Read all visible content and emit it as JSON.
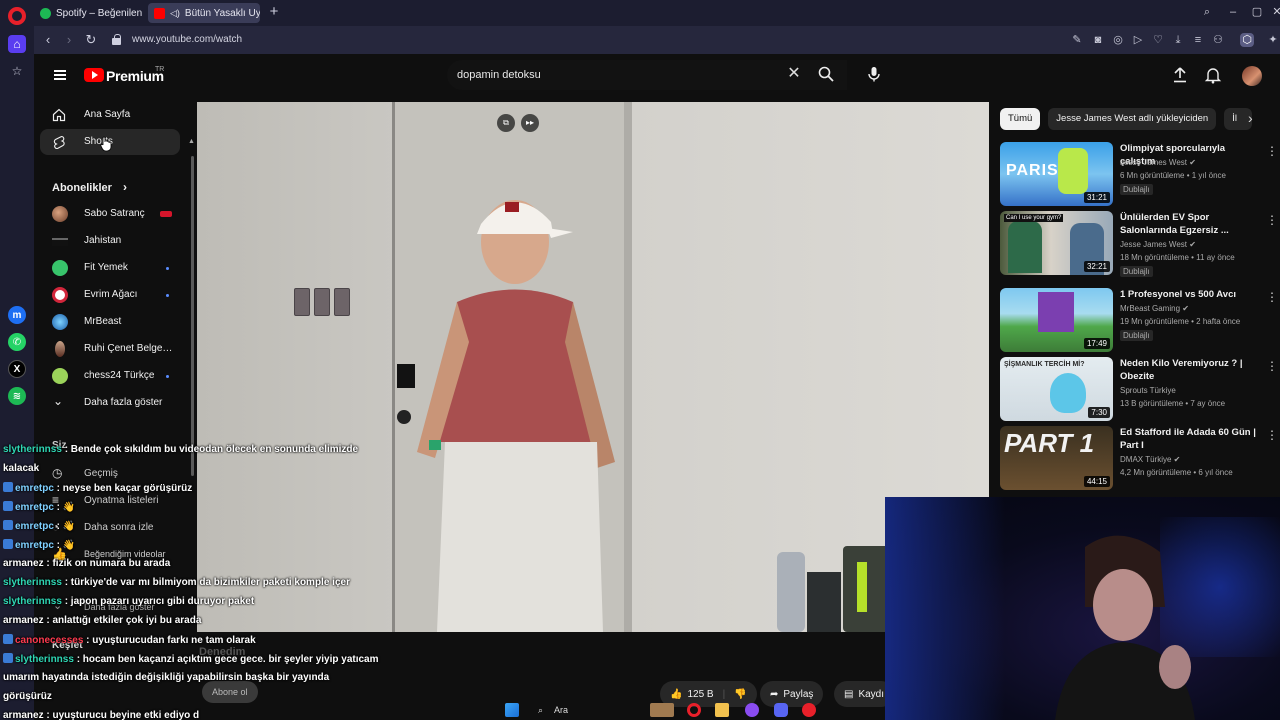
{
  "browser": {
    "tabs": [
      {
        "title": "Spotify – Beğenilen Şarkıl"
      },
      {
        "title": "Bütün Yasaklı Uyarıcıl"
      }
    ],
    "url": "www.youtube.com/watch"
  },
  "youtube": {
    "brand": "Premium",
    "region": "TR",
    "search_value": "dopamin detoksu",
    "sidebar": {
      "items": [
        {
          "label": "Ana Sayfa"
        },
        {
          "label": "Shorts"
        }
      ],
      "subscriptions_heading": "Abonelikler",
      "subscriptions": [
        {
          "name": "Sabo Satranç"
        },
        {
          "name": "Jahistan"
        },
        {
          "name": "Fit Yemek"
        },
        {
          "name": "Evrim Ağacı"
        },
        {
          "name": "MrBeast"
        },
        {
          "name": "Ruhi Çenet Belgese..."
        },
        {
          "name": "chess24 Türkçe"
        }
      ],
      "show_more": "Daha fazla göster",
      "you_heading": "Siz",
      "you_items": [
        {
          "label": "Geçmiş"
        },
        {
          "label": "Oynatma listeleri"
        },
        {
          "label": "Daha sonra izle"
        },
        {
          "label": "Beğendiğim videolar"
        }
      ],
      "show_more_2": "Daha fazla göster",
      "explore_heading": "Keşfet"
    },
    "below_video": {
      "channel_partial": "Denedim",
      "subscribe": "Abone ol",
      "likes": "125 B",
      "share": "Paylaş",
      "save": "Kaydı"
    },
    "filter_chips": [
      "Tümü",
      "Jesse James West adlı yükleyiciden",
      "İl"
    ],
    "recommendations": [
      {
        "title": "Olimpiyat sporcularıyla çalıştım",
        "channel": "Jesse James West",
        "views": "6 Mn görüntüleme • 1 yıl önce",
        "badge": "Dublajlı",
        "duration": "31:21"
      },
      {
        "title": "Ünlülerden EV Spor Salonlarında Egzersiz ...",
        "channel": "Jesse James West",
        "views": "18 Mn görüntüleme • 11 ay önce",
        "badge": "Dublajlı",
        "duration": "32:21"
      },
      {
        "title": "1 Profesyonel vs 500 Avcı",
        "channel": "MrBeast Gaming",
        "views": "19 Mn görüntüleme • 2 hafta önce",
        "badge": "Dublajlı",
        "duration": "17:49"
      },
      {
        "title": "Neden Kilo Veremiyoruz ? | Obezite",
        "channel": "Sprouts Türkiye",
        "views": "13 B görüntüleme • 7 ay önce",
        "badge": "",
        "duration": "7:30"
      },
      {
        "title": "Ed Stafford ile Adada 60 Gün | Part I",
        "channel": "DMAX Türkiye",
        "views": "4,2 Mn görüntüleme • 6 yıl önce",
        "badge": "",
        "duration": "44:15"
      }
    ],
    "thumb_texts": {
      "paris": "PARIS",
      "caption": "Can I use your gym?",
      "sismanlik": "ŞİŞMANLIK TERCİH Mİ?",
      "part": "PART 1"
    }
  },
  "chat": [
    {
      "user": "slytherinnss",
      "user_color": "#2fd7b4",
      "badge": false,
      "text": " : Bende çok sıkıldım bu videodan ölecek en sonunda elimizde"
    },
    {
      "user": "",
      "user_color": "#ffffff",
      "badge": false,
      "text": "kalacak"
    },
    {
      "user": "emretpc",
      "user_color": "#7fd0ff",
      "badge": true,
      "text": " : neyse ben kaçar görüşürüz"
    },
    {
      "user": "emretpc",
      "user_color": "#7fd0ff",
      "badge": true,
      "text": " : 👋"
    },
    {
      "user": "emretpc",
      "user_color": "#7fd0ff",
      "badge": true,
      "text": " : 👋"
    },
    {
      "user": "emretpc",
      "user_color": "#7fd0ff",
      "badge": true,
      "text": " : 👋"
    },
    {
      "user": "armanez",
      "user_color": "#ffffff",
      "badge": false,
      "text": " : fizik on numara bu arada"
    },
    {
      "user": "slytherinnss",
      "user_color": "#2fd7b4",
      "badge": false,
      "text": " : türkiye'de var mı bilmiyom da bizimkiler paketi komple içer"
    },
    {
      "user": "slytherinnss",
      "user_color": "#2fd7b4",
      "badge": false,
      "text": " : japon pazarı uyarıcı gibi duruyor paket"
    },
    {
      "user": "armanez",
      "user_color": "#ffffff",
      "badge": false,
      "text": " : anlattığı etkiler çok iyi bu arada"
    },
    {
      "user": "canonecesses",
      "user_color": "#ff3b4f",
      "badge": true,
      "text": " : uyuşturucudan farkı ne tam olarak"
    },
    {
      "user": "slytherinnss",
      "user_color": "#2fd7b4",
      "badge": true,
      "text": " : hocam ben kaçanzi açıktım gece gece. bir şeyler yiyip yatıcam"
    },
    {
      "user": "",
      "user_color": "#ffffff",
      "badge": false,
      "text": "umarım hayatında istediğin değişikliği yapabilirsin başka bir yayında"
    },
    {
      "user": "",
      "user_color": "#ffffff",
      "badge": false,
      "text": "görüşürüz"
    },
    {
      "user": "armanez",
      "user_color": "#ffffff",
      "badge": false,
      "text": " : uyuşturucu beyine etki ediyo d"
    }
  ],
  "taskbar": {
    "search_label": "Ara"
  },
  "colors": {
    "yt_red": "#ff0000",
    "opera_red": "#e8202a",
    "opera_accent": "#5a3df0",
    "chrome_bg": "#1c1d30"
  }
}
